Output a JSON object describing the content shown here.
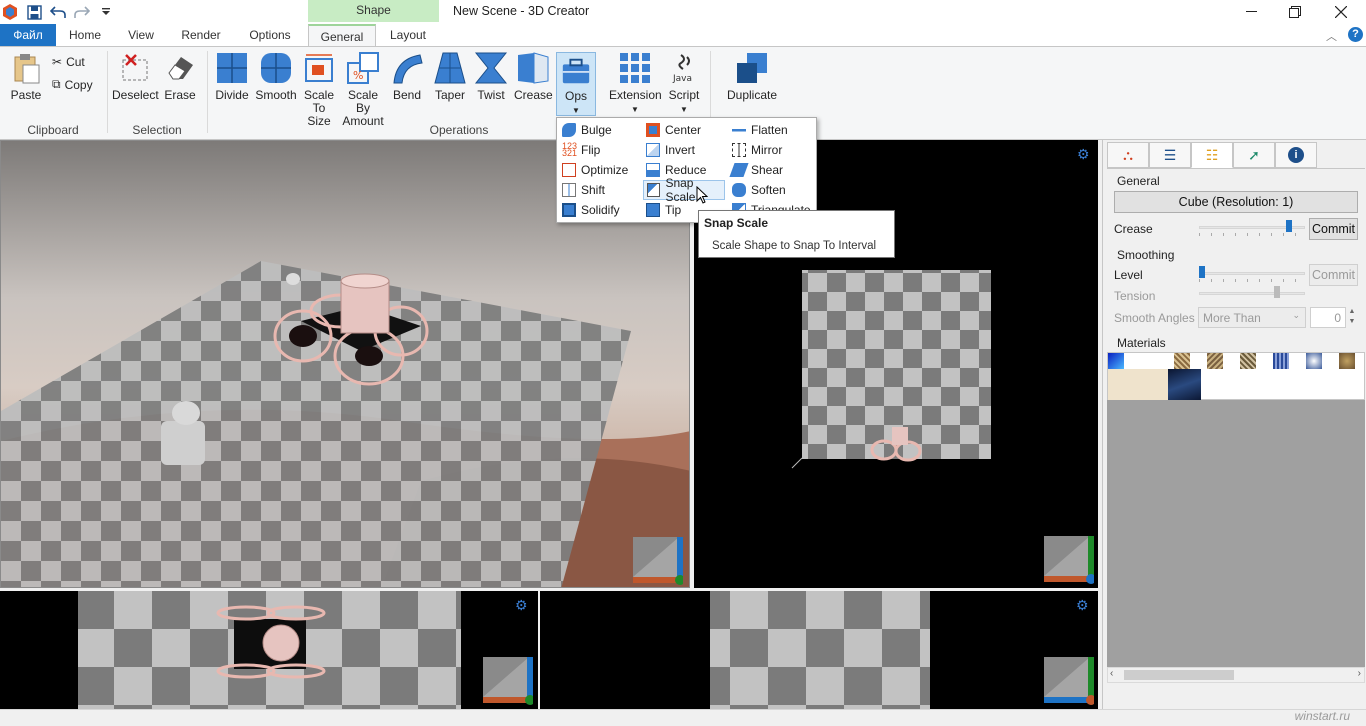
{
  "window": {
    "title": "New Scene - 3D Creator",
    "context_tab_group": "Shape"
  },
  "tabs": [
    "Файл",
    "Home",
    "View",
    "Render",
    "Options",
    "General",
    "Layout"
  ],
  "active_tab": "General",
  "ribbon": {
    "clipboard": {
      "paste": "Paste",
      "cut": "Cut",
      "copy": "Copy",
      "group": "Clipboard"
    },
    "selection": {
      "deselect": "Deselect",
      "erase": "Erase",
      "group": "Selection"
    },
    "operations": {
      "divide": "Divide",
      "smooth": "Smooth",
      "scale_to_size_1": "Scale",
      "scale_to_size_2": "To Size",
      "scale_by_1": "Scale By",
      "scale_by_2": "Amount",
      "bend": "Bend",
      "taper": "Taper",
      "twist": "Twist",
      "crease": "Crease",
      "ops": "Ops",
      "extension": "Extension",
      "java_1": "Java",
      "java_2": "Script",
      "duplicate": "Duplicate",
      "group": "Operations"
    }
  },
  "ops_menu": {
    "col1": [
      "Bulge",
      "Flip",
      "Optimize",
      "Shift",
      "Solidify"
    ],
    "col2": [
      "Center",
      "Invert",
      "Reduce",
      "Snap Scale",
      "Tip"
    ],
    "col3": [
      "Flatten",
      "Mirror",
      "Shear",
      "Soften",
      "Triangulate"
    ],
    "hovered": "Snap Scale"
  },
  "tooltip": {
    "title": "Snap Scale",
    "description": "Scale Shape to Snap To Interval"
  },
  "panel": {
    "general_header": "General",
    "shape_button": "Cube (Resolution: 1)",
    "crease_label": "Crease",
    "commit_label": "Commit",
    "smoothing_header": "Smoothing",
    "level_label": "Level",
    "tension_label": "Tension",
    "smooth_angles_label": "Smooth Angles",
    "smooth_angles_select": "More Than",
    "smooth_angles_value": "0",
    "materials_header": "Materials",
    "crease_value": 0.87,
    "level_value": 0.0,
    "tension_value": 0.75
  },
  "watermark": "winstart.ru",
  "colors": {
    "accent": "#1e73c5",
    "context_tab": "#c8ecc4",
    "gear": "#3b7fd4"
  }
}
